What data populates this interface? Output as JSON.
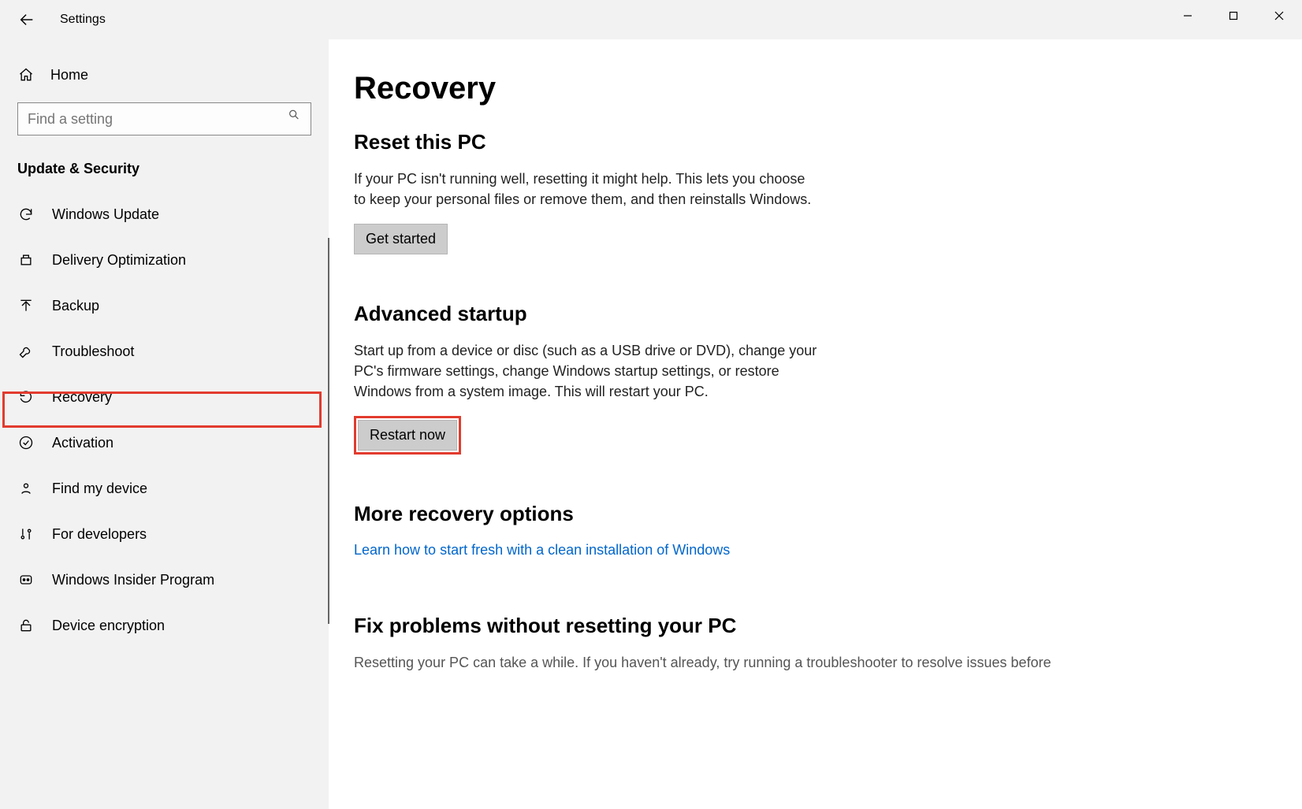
{
  "titlebar": {
    "title": "Settings"
  },
  "sidebar": {
    "home_label": "Home",
    "search_placeholder": "Find a setting",
    "category_label": "Update & Security",
    "items": [
      {
        "label": "Windows Update"
      },
      {
        "label": "Delivery Optimization"
      },
      {
        "label": "Backup"
      },
      {
        "label": "Troubleshoot"
      },
      {
        "label": "Recovery"
      },
      {
        "label": "Activation"
      },
      {
        "label": "Find my device"
      },
      {
        "label": "For developers"
      },
      {
        "label": "Windows Insider Program"
      },
      {
        "label": "Device encryption"
      }
    ]
  },
  "content": {
    "page_title": "Recovery",
    "reset": {
      "heading": "Reset this PC",
      "body": "If your PC isn't running well, resetting it might help. This lets you choose to keep your personal files or remove them, and then reinstalls Windows.",
      "button": "Get started"
    },
    "advanced": {
      "heading": "Advanced startup",
      "body": "Start up from a device or disc (such as a USB drive or DVD), change your PC's firmware settings, change Windows startup settings, or restore Windows from a system image. This will restart your PC.",
      "button": "Restart now"
    },
    "more": {
      "heading": "More recovery options",
      "link": "Learn how to start fresh with a clean installation of Windows"
    },
    "fix": {
      "heading": "Fix problems without resetting your PC",
      "body": "Resetting your PC can take a while. If you haven't already, try running a troubleshooter to resolve issues before"
    }
  },
  "highlight_color": "#e23b2e"
}
